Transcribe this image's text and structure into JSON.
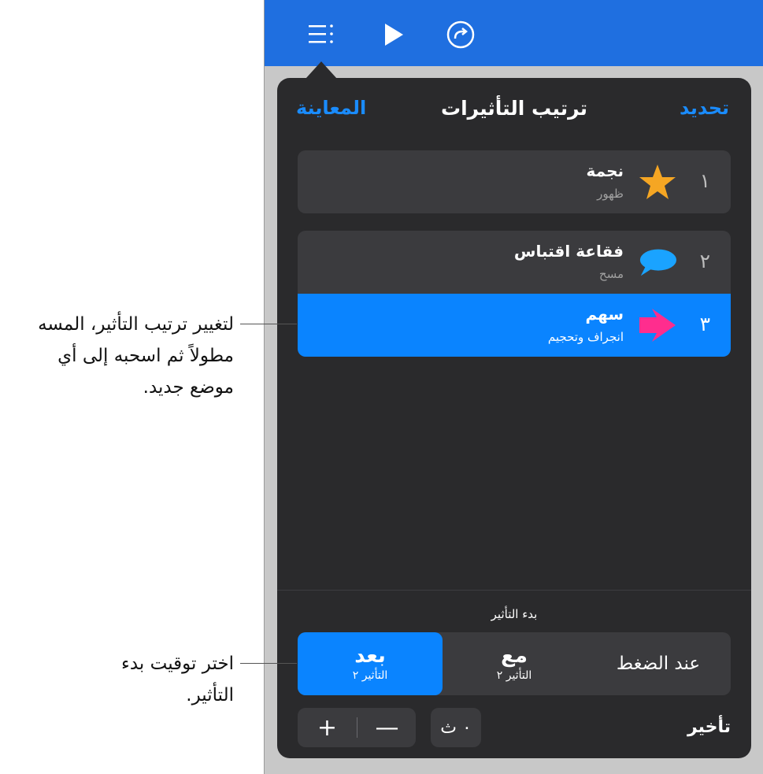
{
  "toolbar": {
    "icons": [
      "list-icon",
      "play-icon",
      "redo-icon"
    ],
    "color": "#1f6fe0"
  },
  "popover": {
    "title": "ترتيب التأثيرات",
    "left_link": "المعاينة",
    "right_link": "تحديد"
  },
  "effects": [
    {
      "num": "١",
      "name": "نجمة",
      "type": "ظهور",
      "icon": "star-icon"
    },
    {
      "num": "٢",
      "name": "فقاعة اقتباس",
      "type": "مسح",
      "icon": "speech-bubble-icon"
    },
    {
      "num": "٣",
      "name": "سهم",
      "type": "انجراف وتحجيم",
      "icon": "arrow-icon",
      "selected": true
    }
  ],
  "start": {
    "label": "بدء التأثير",
    "options": [
      {
        "title": "عند الضغط",
        "sub": ""
      },
      {
        "title": "مع",
        "sub": "التأثير ٢"
      },
      {
        "title": "بعد",
        "sub": "التأثير ٢",
        "selected": true
      }
    ]
  },
  "delay": {
    "label": "تأخير",
    "value": "٠ ث",
    "plus": "+",
    "minus": "—"
  },
  "callouts": {
    "reorder": [
      "لتغيير ترتيب التأثير، المسه",
      "مطولاً ثم اسحبه إلى أي",
      "موضع جديد."
    ],
    "timing": [
      "اختر توقيت بدء",
      "التأثير."
    ]
  },
  "colors": {
    "accent": "#0a84ff",
    "popover": "#2a2a2c",
    "row": "#3b3b3e",
    "star": "#f5a623",
    "bubble": "#1aa3ff",
    "arrow": "#ff2d8e"
  }
}
